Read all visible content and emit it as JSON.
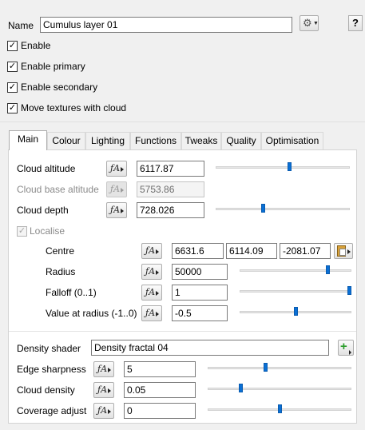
{
  "header": {
    "name_label": "Name",
    "name_value": "Cumulus layer 01",
    "help_label": "?"
  },
  "checkboxes": [
    {
      "label": "Enable",
      "checked": true
    },
    {
      "label": "Enable primary",
      "checked": true
    },
    {
      "label": "Enable secondary",
      "checked": true
    },
    {
      "label": "Move textures with cloud",
      "checked": true
    }
  ],
  "tabs": [
    "Main",
    "Colour",
    "Lighting",
    "Functions",
    "Tweaks",
    "Quality",
    "Optimisation"
  ],
  "active_tab": "Main",
  "main": {
    "cloud_altitude": {
      "label": "Cloud altitude",
      "value": "6117.87",
      "slider": 0.55
    },
    "cloud_base_altitude": {
      "label": "Cloud base altitude",
      "value": "5753.86"
    },
    "cloud_depth": {
      "label": "Cloud depth",
      "value": "728.026",
      "slider": 0.35
    },
    "localise": {
      "label": "Localise",
      "checked": true
    },
    "centre": {
      "label": "Centre",
      "x": "6631.6",
      "y": "6114.09",
      "z": "-2081.07"
    },
    "radius": {
      "label": "Radius",
      "value": "50000",
      "slider": 0.8
    },
    "falloff": {
      "label": "Falloff (0..1)",
      "value": "1",
      "slider": 1.0
    },
    "value_at_radius": {
      "label": "Value at radius (-1..0)",
      "value": "-0.5",
      "slider": 0.5
    },
    "density_shader": {
      "label": "Density shader",
      "value": "Density fractal 04"
    },
    "edge_sharpness": {
      "label": "Edge sharpness",
      "value": "5",
      "slider": 0.4
    },
    "cloud_density": {
      "label": "Cloud density",
      "value": "0.05",
      "slider": 0.22
    },
    "coverage_adjust": {
      "label": "Coverage adjust",
      "value": "0",
      "slider": 0.5
    }
  },
  "function_button_label": "ƒA",
  "icons": {
    "settings": "gear-icon",
    "function": "function-curve-icon",
    "paste": "clipboard-icon",
    "add": "plus-icon"
  },
  "colors": {
    "accent": "#0a6fd4",
    "add_green": "#2a9d2a"
  }
}
